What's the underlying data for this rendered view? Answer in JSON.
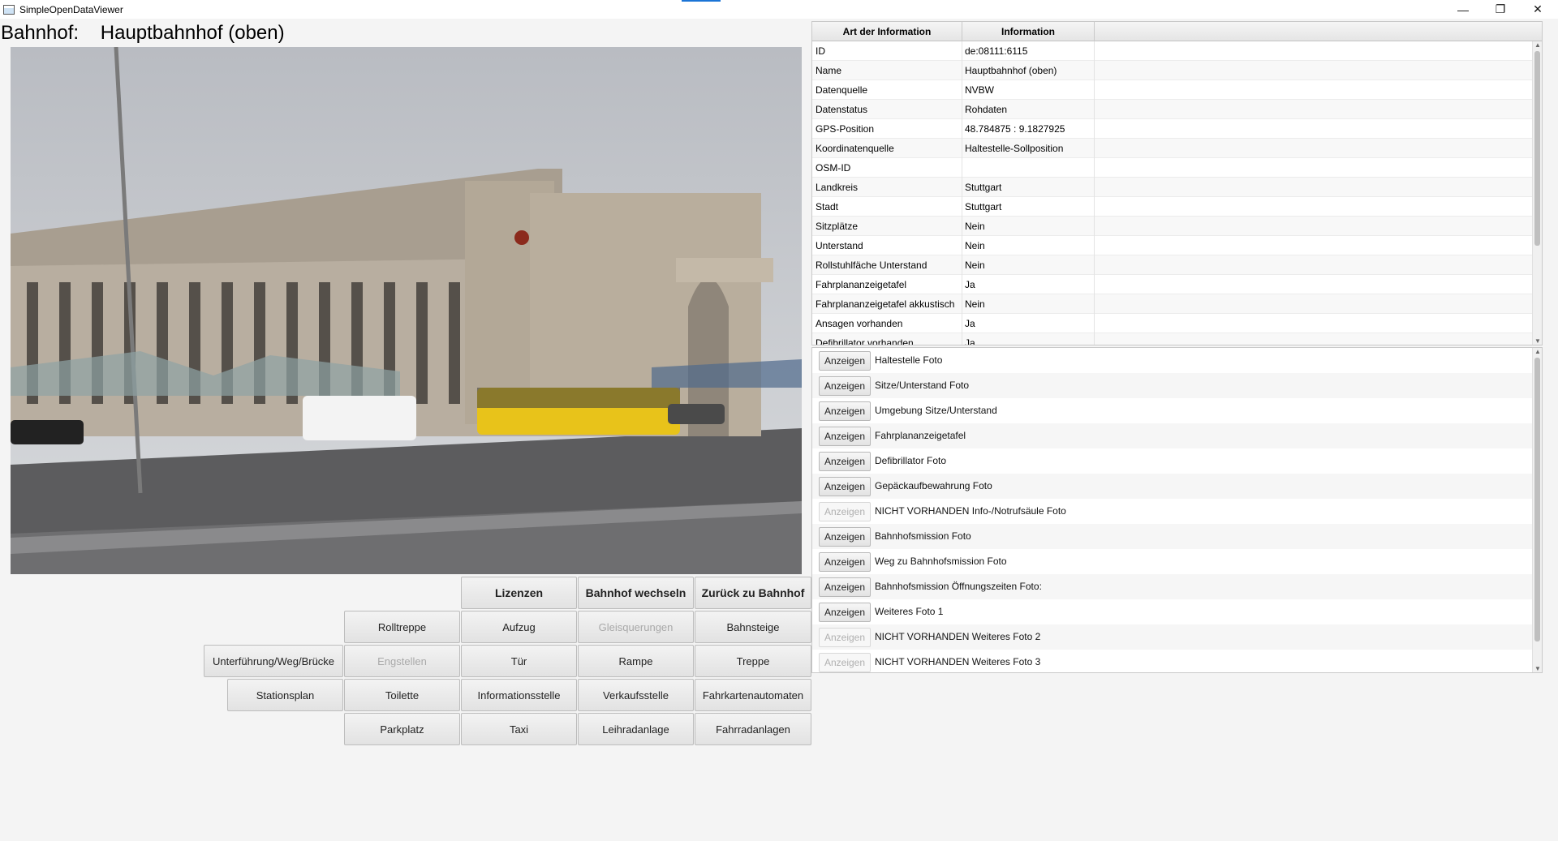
{
  "window": {
    "title": "SimpleOpenDataViewer",
    "minimize": "—",
    "maximize": "❐",
    "close": "✕"
  },
  "station": {
    "label": "Bahnhof:",
    "name": "Hauptbahnhof (oben)"
  },
  "buttons": {
    "lizenzen": "Lizenzen",
    "bahnhof_wechseln": "Bahnhof wechseln",
    "zurueck": "Zurück zu Bahnhof",
    "rolltreppe": "Rolltreppe",
    "aufzug": "Aufzug",
    "gleisquerungen": "Gleisquerungen",
    "bahnsteige": "Bahnsteige",
    "unterfuehrung": "Unterführung/Weg/Brücke",
    "engstellen": "Engstellen",
    "tuer": "Tür",
    "rampe": "Rampe",
    "treppe": "Treppe",
    "stationsplan": "Stationsplan",
    "toilette": "Toilette",
    "informationsstelle": "Informationsstelle",
    "verkaufsstelle": "Verkaufsstelle",
    "fahrkartenautomaten": "Fahrkartenautomaten",
    "parkplatz": "Parkplatz",
    "taxi": "Taxi",
    "leihradanlage": "Leihradanlage",
    "fahrradanlagen": "Fahrradanlagen"
  },
  "info_table": {
    "headers": [
      "Art der Information",
      "Information"
    ],
    "rows": [
      {
        "key": "ID",
        "value": "de:08111:6115"
      },
      {
        "key": "Name",
        "value": "Hauptbahnhof (oben)"
      },
      {
        "key": "Datenquelle",
        "value": "NVBW"
      },
      {
        "key": "Datenstatus",
        "value": "Rohdaten"
      },
      {
        "key": "GPS-Position",
        "value": "48.784875 : 9.1827925"
      },
      {
        "key": "Koordinatenquelle",
        "value": "Haltestelle-Sollposition"
      },
      {
        "key": "OSM-ID",
        "value": ""
      },
      {
        "key": "Landkreis",
        "value": "Stuttgart"
      },
      {
        "key": "Stadt",
        "value": "Stuttgart"
      },
      {
        "key": "Sitzplätze",
        "value": "Nein"
      },
      {
        "key": "Unterstand",
        "value": "Nein"
      },
      {
        "key": "Rollstuhlfäche Unterstand",
        "value": "Nein"
      },
      {
        "key": "Fahrplananzeigetafel",
        "value": "Ja"
      },
      {
        "key": "Fahrplananzeigetafel akkustisch",
        "value": "Nein"
      },
      {
        "key": "Ansagen vorhanden",
        "value": "Ja"
      },
      {
        "key": "Defibrillator vorhanden",
        "value": "Ja"
      }
    ]
  },
  "photo_list": {
    "button_label": "Anzeigen",
    "items": [
      {
        "text": "Haltestelle Foto",
        "enabled": true
      },
      {
        "text": "Sitze/Unterstand Foto",
        "enabled": true
      },
      {
        "text": "Umgebung Sitze/Unterstand",
        "enabled": true
      },
      {
        "text": "Fahrplananzeigetafel",
        "enabled": true
      },
      {
        "text": "Defibrillator Foto",
        "enabled": true
      },
      {
        "text": "Gepäckaufbewahrung Foto",
        "enabled": true
      },
      {
        "text": "NICHT VORHANDEN Info-/Notrufsäule Foto",
        "enabled": false
      },
      {
        "text": "Bahnhofsmission Foto",
        "enabled": true
      },
      {
        "text": "Weg zu Bahnhofsmission Foto",
        "enabled": true
      },
      {
        "text": "Bahnhofsmission Öffnungszeiten Foto:",
        "enabled": true
      },
      {
        "text": "Weiteres Foto 1",
        "enabled": true
      },
      {
        "text": "NICHT VORHANDEN Weiteres Foto 2",
        "enabled": false
      },
      {
        "text": "NICHT VORHANDEN Weiteres Foto 3",
        "enabled": false
      }
    ]
  }
}
